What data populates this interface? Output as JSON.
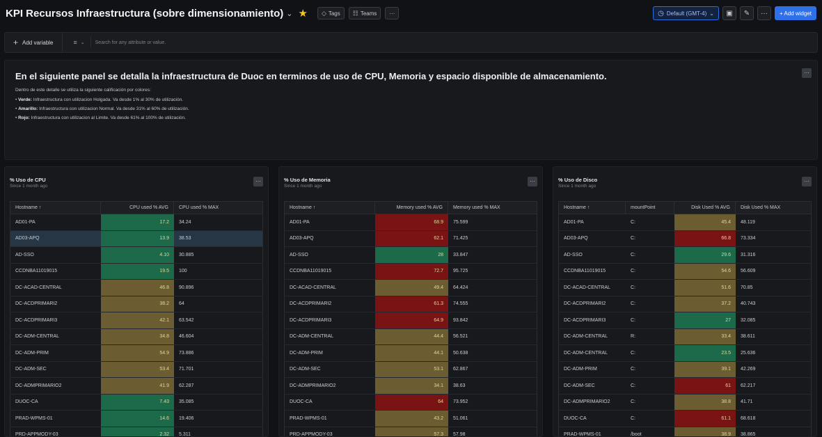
{
  "header": {
    "title": "KPI Recursos Infraestructura (sobre dimensionamiento)",
    "title_chevron": "⌄",
    "star": "★",
    "tags_label": "Tags",
    "teams_label": "Teams",
    "more": "···",
    "timezone": "Default (GMT-4)",
    "timezone_chevron": "⌄",
    "add_widget": "+ Add widget"
  },
  "toolbar": {
    "add_variable": "Add variable",
    "search_placeholder": "Search for any attribute or value."
  },
  "info_panel": {
    "heading": "En el siguiente panel se detalla la infraestructura de Duoc en terminos de uso de CPU, Memoria y espacio disponible de almacenamiento.",
    "intro": "Dentro de este detalle se utiliza la siguiente calificación por colores:",
    "items": [
      {
        "label": "Verde:",
        "text": "Infraestructura con utilizacion Holgada. Va desde 1% al 30% de utilización."
      },
      {
        "label": "Amarillo:",
        "text": "Infraestructura con utilizacion Normal. Va desde 31% al 60% de utilización."
      },
      {
        "label": "Rojo:",
        "text": "Infraestructura con utilizacion al Limite. Va desde 61% al 100% de utilización."
      }
    ]
  },
  "panels": {
    "cpu": {
      "title": "% Uso de CPU",
      "subtitle": "Since 1 month ago",
      "columns": [
        "Hostname ↑",
        "CPU used % AVG",
        "CPU used % MAX"
      ],
      "rows": [
        {
          "host": "AD01-PA",
          "avg": "17.2",
          "max": "34.24",
          "color": "green"
        },
        {
          "host": "AD03-APQ",
          "avg": "13.9",
          "max": "38.53",
          "color": "green"
        },
        {
          "host": "AD-SSO",
          "avg": "4.10",
          "max": "30.885",
          "color": "green"
        },
        {
          "host": "CCDNBA11019015",
          "avg": "19.5",
          "max": "100",
          "color": "green"
        },
        {
          "host": "DC-ACAD-CENTRAL",
          "avg": "46.8",
          "max": "90.896",
          "color": "amber"
        },
        {
          "host": "DC-ACDPRIMARI2",
          "avg": "38.2",
          "max": "64",
          "color": "amber"
        },
        {
          "host": "DC-ACDPRIMARI3",
          "avg": "42.1",
          "max": "63.542",
          "color": "amber"
        },
        {
          "host": "DC-ADM-CENTRAL",
          "avg": "34.8",
          "max": "46.604",
          "color": "amber"
        },
        {
          "host": "DC-ADM-PRIM",
          "avg": "54.9",
          "max": "73.886",
          "color": "amber"
        },
        {
          "host": "DC-ADM-SEC",
          "avg": "53.4",
          "max": "71.701",
          "color": "amber"
        },
        {
          "host": "DC-ADMPRIMARIO2",
          "avg": "41.9",
          "max": "62.287",
          "color": "amber"
        },
        {
          "host": "DUOC-CA",
          "avg": "7.43",
          "max": "35.085",
          "color": "green"
        },
        {
          "host": "PRAD-WPMS-01",
          "avg": "14.6",
          "max": "19.406",
          "color": "green"
        },
        {
          "host": "PRD-APPMODY-03",
          "avg": "2.32",
          "max": "5.311",
          "color": "green"
        }
      ]
    },
    "memory": {
      "title": "% Uso de Memoria",
      "subtitle": "Since 1 month ago",
      "columns": [
        "Hostname ↑",
        "Memory used % AVG",
        "Memory used % MAX"
      ],
      "rows": [
        {
          "host": "AD01-PA",
          "avg": "68.9",
          "max": "75.599",
          "color": "red"
        },
        {
          "host": "AD03-APQ",
          "avg": "62.1",
          "max": "71.425",
          "color": "red"
        },
        {
          "host": "AD-SSO",
          "avg": "28",
          "max": "33.847",
          "color": "green"
        },
        {
          "host": "CCDNBA11019015",
          "avg": "72.7",
          "max": "95.725",
          "color": "red"
        },
        {
          "host": "DC-ACAD-CENTRAL",
          "avg": "49.4",
          "max": "64.424",
          "color": "amber"
        },
        {
          "host": "DC-ACDPRIMARI2",
          "avg": "61.3",
          "max": "74.555",
          "color": "red"
        },
        {
          "host": "DC-ACDPRIMARI3",
          "avg": "64.9",
          "max": "93.842",
          "color": "red"
        },
        {
          "host": "DC-ADM-CENTRAL",
          "avg": "44.4",
          "max": "56.521",
          "color": "amber"
        },
        {
          "host": "DC-ADM-PRIM",
          "avg": "44.1",
          "max": "50.638",
          "color": "amber"
        },
        {
          "host": "DC-ADM-SEC",
          "avg": "53.1",
          "max": "62.867",
          "color": "amber"
        },
        {
          "host": "DC-ADMPRIMARIO2",
          "avg": "34.1",
          "max": "38.63",
          "color": "amber"
        },
        {
          "host": "DUOC-CA",
          "avg": "64",
          "max": "73.952",
          "color": "red"
        },
        {
          "host": "PRAD-WPMS-01",
          "avg": "43.2",
          "max": "51.061",
          "color": "amber"
        },
        {
          "host": "PRD-APPMODY-03",
          "avg": "57.3",
          "max": "57.98",
          "color": "amber"
        }
      ]
    },
    "disk": {
      "title": "% Uso de Disco",
      "subtitle": "Since 1 month ago",
      "columns": [
        "Hostname ↑",
        "mountPoint",
        "Disk Used % AVG",
        "Disk Used % MAX"
      ],
      "rows": [
        {
          "host": "AD01-PA",
          "mount": "C:",
          "avg": "45.4",
          "max": "48.119",
          "color": "amber"
        },
        {
          "host": "AD03-APQ",
          "mount": "C:",
          "avg": "66.8",
          "max": "73.334",
          "color": "red"
        },
        {
          "host": "AD-SSO",
          "mount": "C:",
          "avg": "29.6",
          "max": "31.316",
          "color": "green"
        },
        {
          "host": "CCDNBA11019015",
          "mount": "C:",
          "avg": "54.6",
          "max": "56.609",
          "color": "amber"
        },
        {
          "host": "DC-ACAD-CENTRAL",
          "mount": "C:",
          "avg": "51.6",
          "max": "70.85",
          "color": "amber"
        },
        {
          "host": "DC-ACDPRIMARI2",
          "mount": "C:",
          "avg": "37.2",
          "max": "40.743",
          "color": "amber"
        },
        {
          "host": "DC-ACDPRIMARI3",
          "mount": "C:",
          "avg": "27",
          "max": "32.085",
          "color": "green"
        },
        {
          "host": "DC-ADM-CENTRAL",
          "mount": "R:",
          "avg": "33.4",
          "max": "38.611",
          "color": "amber"
        },
        {
          "host": "DC-ADM-CENTRAL",
          "mount": "C:",
          "avg": "23.5",
          "max": "25.636",
          "color": "green"
        },
        {
          "host": "DC-ADM-PRIM",
          "mount": "C:",
          "avg": "39.1",
          "max": "42.269",
          "color": "amber"
        },
        {
          "host": "DC-ADM-SEC",
          "mount": "C:",
          "avg": "61",
          "max": "62.217",
          "color": "red"
        },
        {
          "host": "DC-ADMPRIMARIO2",
          "mount": "C:",
          "avg": "38.8",
          "max": "41.71",
          "color": "amber"
        },
        {
          "host": "DUOC-CA",
          "mount": "C:",
          "avg": "61.1",
          "max": "68.618",
          "color": "red"
        },
        {
          "host": "PRAD-WPMS-01",
          "mount": "/boot",
          "avg": "38.9",
          "max": "38.865",
          "color": "amber"
        }
      ]
    }
  },
  "colors": {
    "green": "#1d6a4a",
    "amber": "#6c5c31",
    "red": "#7a1414",
    "accent": "#2f6fe8"
  }
}
